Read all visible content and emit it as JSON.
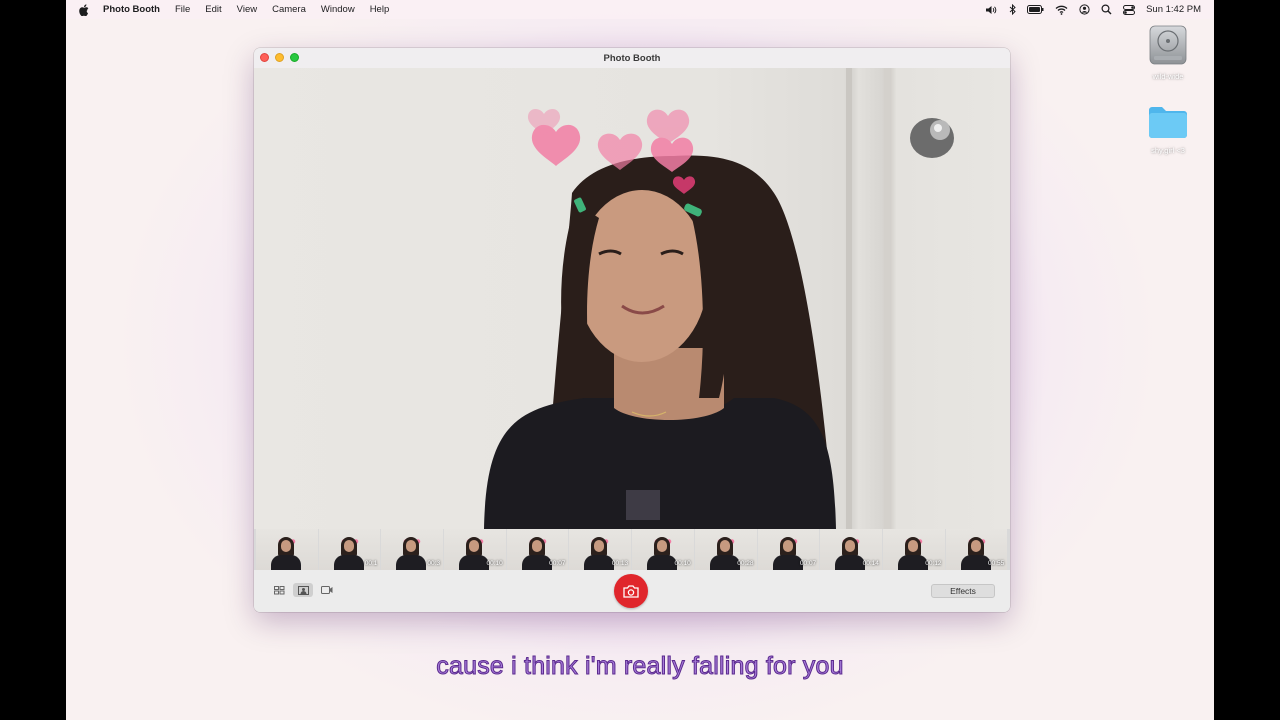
{
  "menubar": {
    "app_name": "Photo Booth",
    "items": [
      "File",
      "Edit",
      "View",
      "Camera",
      "Window",
      "Help"
    ],
    "clock": "Sun 1:42 PM"
  },
  "desktop": {
    "icons": [
      {
        "label": "wild-wide",
        "icon": "hard-drive-icon"
      },
      {
        "label": "shy.girl <3",
        "icon": "folder-icon"
      }
    ]
  },
  "window": {
    "title": "Photo Booth",
    "effects_label": "Effects",
    "filmstrip": [
      {
        "duration": ""
      },
      {
        "duration": "00:1"
      },
      {
        "duration": "00:3"
      },
      {
        "duration": "00:10"
      },
      {
        "duration": "00:07"
      },
      {
        "duration": "00:13"
      },
      {
        "duration": "00:10"
      },
      {
        "duration": "00:28"
      },
      {
        "duration": "00:07"
      },
      {
        "duration": "00:14"
      },
      {
        "duration": "00:12"
      },
      {
        "duration": "00:55"
      }
    ]
  },
  "caption": "cause i think i'm really falling for you",
  "colors": {
    "shutter": "#e0262c",
    "caption_fill": "#a67bd8",
    "caption_stroke": "#5b2a8e",
    "hearts": "#f27ea5"
  }
}
